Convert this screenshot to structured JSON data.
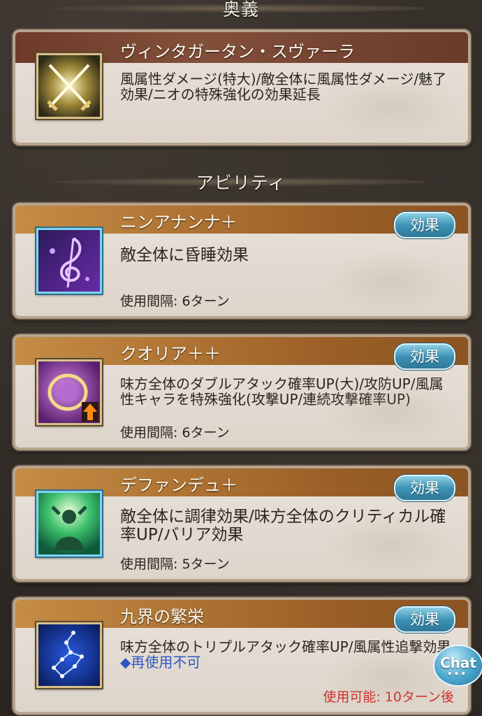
{
  "sections": {
    "ougi_title": "奥義",
    "ability_title": "アビリティ"
  },
  "ougi": {
    "name": "ヴィンタガータン・スヴァーラ",
    "description": "風属性ダメージ(特大)/敵全体に風属性ダメージ/魅了効果/ニオの特殊強化の効果延長",
    "icon": "crossed-swords-icon"
  },
  "abilities": [
    {
      "name": "ニンアナンナ＋",
      "description": "敵全体に昏睡効果",
      "cooldown": "使用間隔: 6ターン",
      "button": "効果",
      "icon": "treble-clef-icon"
    },
    {
      "name": "クオリア＋＋",
      "description": "味方全体のダブルアタック確率UP(大)/攻防UP/風属性キャラを特殊強化(攻撃UP/連続攻撃確率UP)",
      "cooldown": "使用間隔: 6ターン",
      "button": "効果",
      "icon": "bracelet-up-icon"
    },
    {
      "name": "デファンデュ＋",
      "description": "敵全体に調律効果/味方全体のクリティカル確率UP/バリア効果",
      "cooldown": "使用間隔: 5ターン",
      "button": "効果",
      "icon": "shield-figure-icon"
    },
    {
      "name": "九界の繁栄",
      "description": "味方全体のトリプルアタック確率UP/風属性追撃効果",
      "note": "◆再使用不可",
      "availability": "使用可能: 10ターン後",
      "button": "効果",
      "icon": "constellation-icon"
    }
  ],
  "chat_button": "Chat",
  "colors": {
    "effect_button": "#3f93b4",
    "availability_text": "#d0302c",
    "no_reuse_text": "#2c58c4"
  }
}
